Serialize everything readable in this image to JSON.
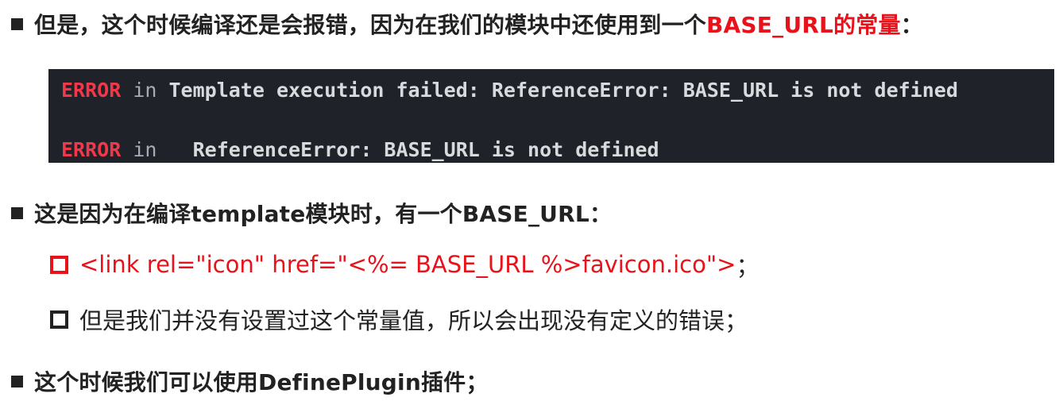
{
  "bullets": {
    "b1": {
      "text_before": "但是，这个时候编译还是会报错，因为在我们的模块中还使用到一个",
      "highlight": "BASE_URL的常量",
      "text_after": "："
    },
    "b2": {
      "text": "这是因为在编译template模块时，有一个BASE_URL："
    },
    "b3": {
      "text": "这个时候我们可以使用DefinePlugin插件；"
    }
  },
  "terminal": {
    "line1": {
      "level": "ERROR",
      "keyword": "in",
      "message": "Template execution failed: ReferenceError: BASE_URL is not defined"
    },
    "line2": {
      "level": "ERROR",
      "keyword": "in",
      "message": "  ReferenceError: BASE_URL is not defined"
    }
  },
  "sub_bullets": {
    "s1": {
      "code": "<link rel=\"icon\" href=\"<%= BASE_URL %>favicon.ico\">",
      "suffix": "；"
    },
    "s2": {
      "text": "但是我们并没有设置过这个常量值，所以会出现没有定义的错误；"
    }
  },
  "colors": {
    "highlight_red": "#e8131a",
    "terminal_bg": "#1f2329",
    "error_red": "#f0384a",
    "text_dark": "#222222"
  }
}
